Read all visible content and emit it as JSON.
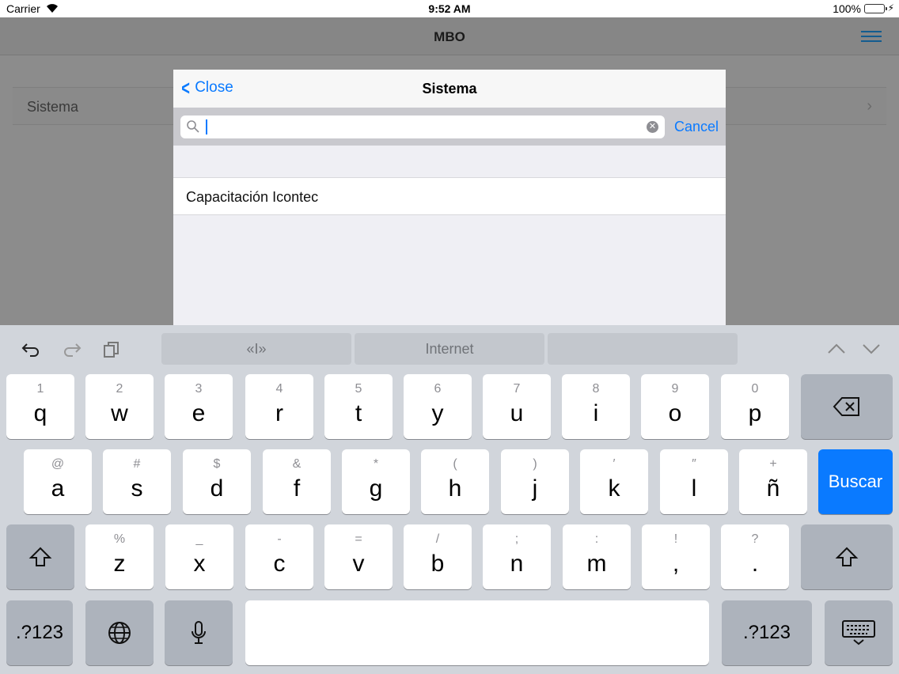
{
  "status_bar": {
    "carrier": "Carrier",
    "time": "9:52 AM",
    "battery": "100%"
  },
  "navbar": {
    "title": "MBO"
  },
  "background_list": {
    "row_label": "Sistema"
  },
  "modal": {
    "back_label": "Close",
    "title": "Sistema",
    "search": {
      "value": "",
      "cancel_label": "Cancel"
    },
    "results": [
      "Capacitación Icontec"
    ]
  },
  "keyboard": {
    "suggestions": [
      "«I»",
      "Internet",
      ""
    ],
    "row1": [
      {
        "sub": "1",
        "main": "q"
      },
      {
        "sub": "2",
        "main": "w"
      },
      {
        "sub": "3",
        "main": "e"
      },
      {
        "sub": "4",
        "main": "r"
      },
      {
        "sub": "5",
        "main": "t"
      },
      {
        "sub": "6",
        "main": "y"
      },
      {
        "sub": "7",
        "main": "u"
      },
      {
        "sub": "8",
        "main": "i"
      },
      {
        "sub": "9",
        "main": "o"
      },
      {
        "sub": "0",
        "main": "p"
      }
    ],
    "row2": [
      {
        "sub": "@",
        "main": "a"
      },
      {
        "sub": "#",
        "main": "s"
      },
      {
        "sub": "$",
        "main": "d"
      },
      {
        "sub": "&",
        "main": "f"
      },
      {
        "sub": "*",
        "main": "g"
      },
      {
        "sub": "(",
        "main": "h"
      },
      {
        "sub": ")",
        "main": "j"
      },
      {
        "sub": "′",
        "main": "k"
      },
      {
        "sub": "″",
        "main": "l"
      },
      {
        "sub": "+",
        "main": "ñ"
      }
    ],
    "row3": [
      {
        "sub": "%",
        "main": "z"
      },
      {
        "sub": "_",
        "main": "x"
      },
      {
        "sub": "-",
        "main": "c"
      },
      {
        "sub": "=",
        "main": "v"
      },
      {
        "sub": "/",
        "main": "b"
      },
      {
        "sub": ";",
        "main": "n"
      },
      {
        "sub": ":",
        "main": "m"
      },
      {
        "sub": "!",
        "main": ","
      },
      {
        "sub": "?",
        "main": "."
      }
    ],
    "return_label": "Buscar",
    "numbers_label": ".?123"
  }
}
